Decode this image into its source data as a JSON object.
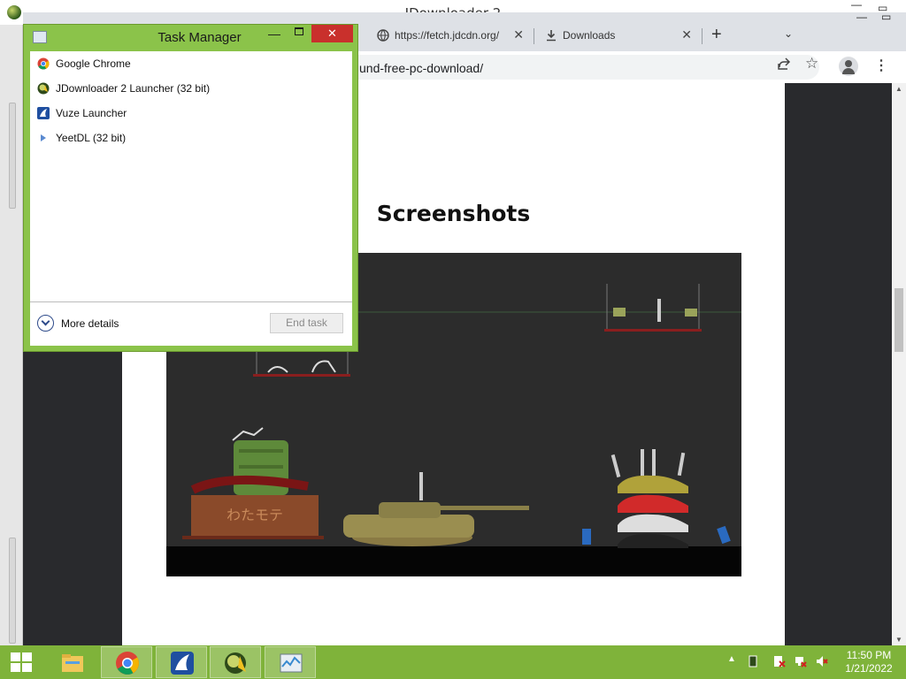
{
  "jdownloader": {
    "title": "JDownloader 2"
  },
  "chrome": {
    "tabs": [
      {
        "label": "https://fetch.jdcdn.org/",
        "icon": "globe-icon"
      },
      {
        "label": "Downloads",
        "icon": "download-icon"
      }
    ],
    "url": "und-free-pc-download/",
    "page": {
      "heading": "Screenshots"
    }
  },
  "task_manager": {
    "title": "Task Manager",
    "processes": [
      {
        "name": "Google Chrome",
        "icon": "chrome-icon"
      },
      {
        "name": "JDownloader 2 Launcher (32 bit)",
        "icon": "jdownloader-icon"
      },
      {
        "name": "Vuze Launcher",
        "icon": "vuze-icon"
      },
      {
        "name": "YeetDL (32 bit)",
        "icon": "yeetdl-icon"
      }
    ],
    "more_details_label": "More details",
    "end_task_label": "End task"
  },
  "taskbar": {
    "pinned": [
      "file-explorer-icon",
      "chrome-icon",
      "vuze-icon",
      "jdownloader-icon",
      "task-manager-icon"
    ],
    "clock_time": "11:50 PM",
    "clock_date": "1/21/2022"
  },
  "colors": {
    "accent_green": "#8bc34a",
    "taskbar_green": "#7fb33a",
    "close_red": "#c9302c"
  }
}
